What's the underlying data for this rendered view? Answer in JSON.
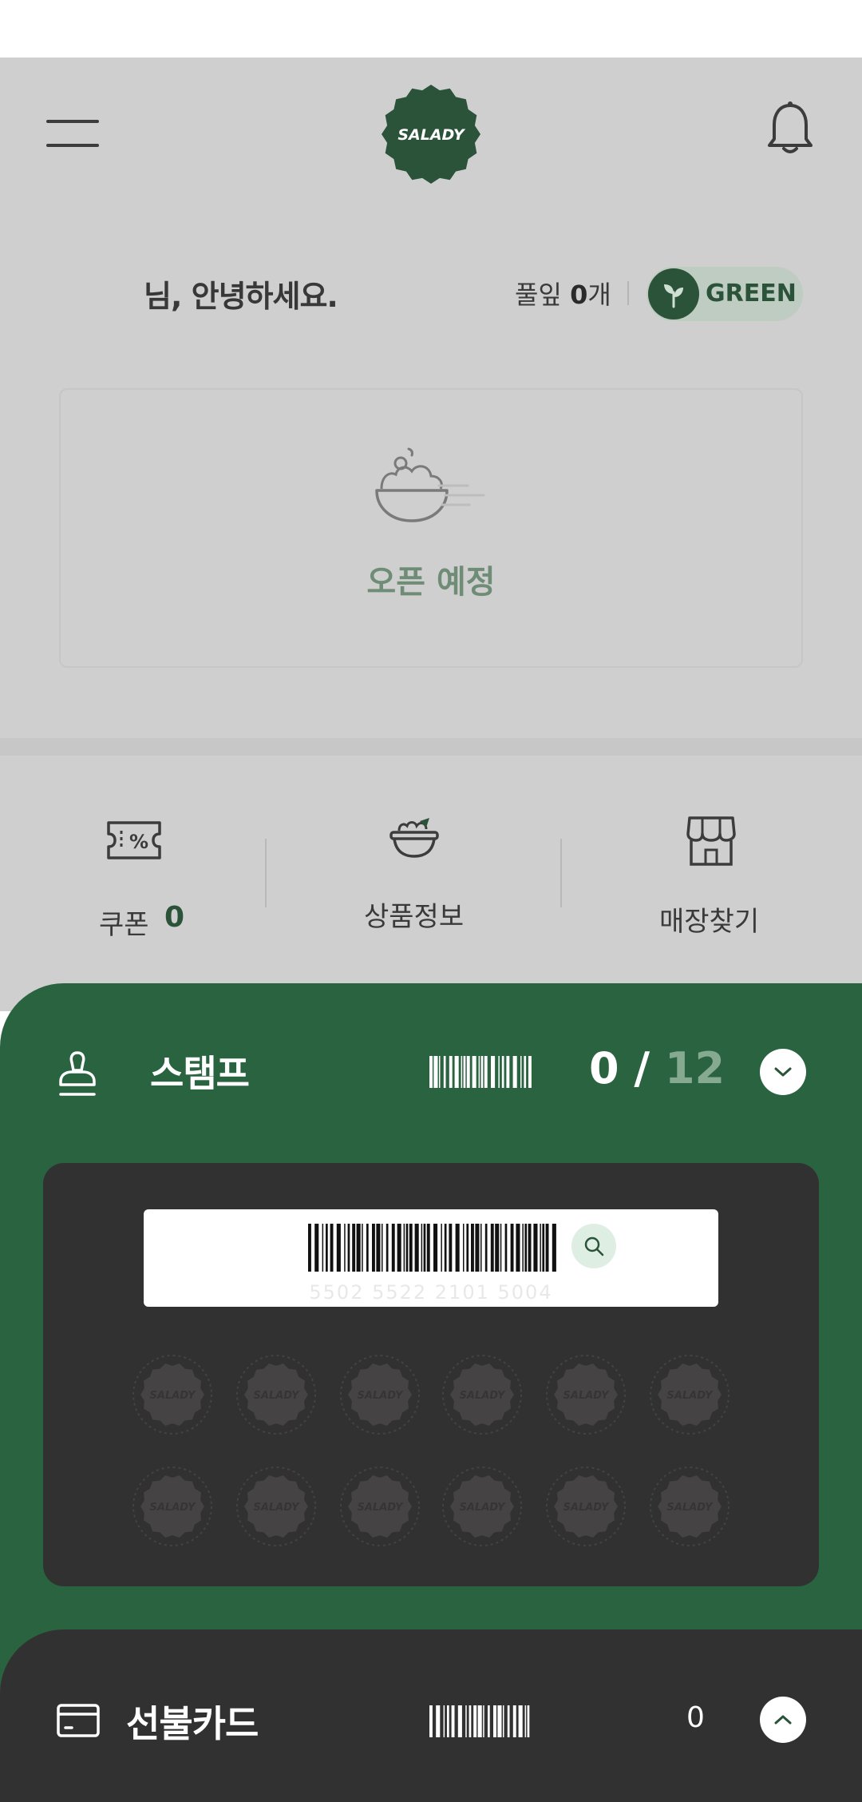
{
  "header": {
    "logo_text": "SALADY",
    "menu_icon": "hamburger-menu-icon",
    "bell_icon": "bell-icon"
  },
  "profile": {
    "greeting": "님, 안녕하세요.",
    "leaf_label": "풀잎",
    "leaf_count": "0",
    "leaf_unit": "개",
    "grade": "GREEN"
  },
  "store_card": {
    "status_text": "오픈 예정",
    "icon": "salad-bowl-icon"
  },
  "quick_menu": {
    "coupon_label": "쿠폰",
    "coupon_count": "0",
    "product_label": "상품정보",
    "store_label": "매장찾기"
  },
  "stamp": {
    "title": "스탬프",
    "current": "0",
    "separator": "/",
    "total": "12",
    "barcode_number": "5502 5522 2101 5004",
    "slots": [
      {
        "label": "SALADY"
      },
      {
        "label": "SALADY"
      },
      {
        "label": "SALADY"
      },
      {
        "label": "SALADY"
      },
      {
        "label": "SALADY"
      },
      {
        "label": "SALADY"
      },
      {
        "label": "SALADY"
      },
      {
        "label": "SALADY"
      },
      {
        "label": "SALADY"
      },
      {
        "label": "SALADY"
      },
      {
        "label": "SALADY"
      },
      {
        "label": "SALADY"
      }
    ]
  },
  "prepaid": {
    "title": "선불카드",
    "balance": "0"
  },
  "colors": {
    "brand_green": "#29633f",
    "dark_green": "#2a5339",
    "overlay_gray": "#cfcfcf",
    "dark_card": "#323131",
    "muted_green": "#85aa8f"
  }
}
